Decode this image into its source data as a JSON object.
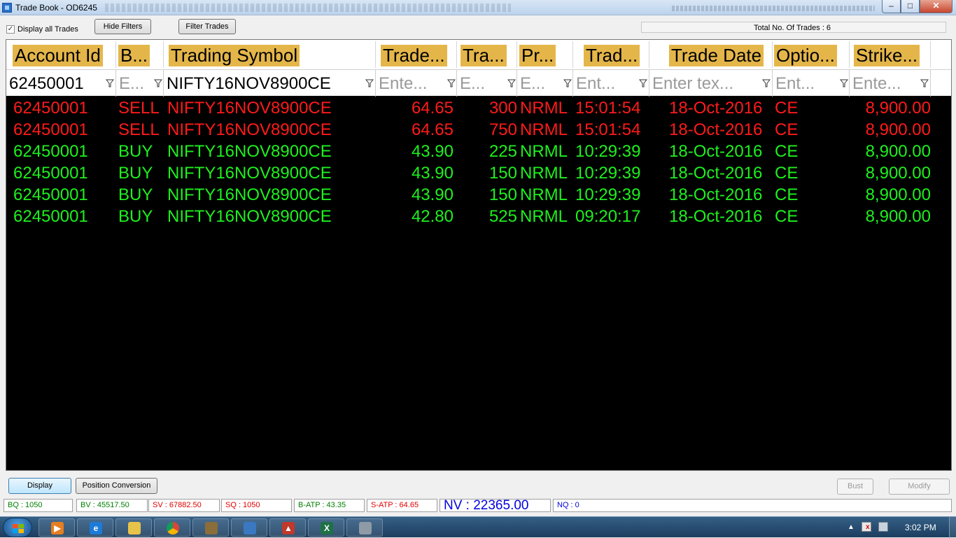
{
  "window": {
    "title": "Trade Book - OD6245"
  },
  "toolbar": {
    "display_all_label": "Display all Trades",
    "display_all_checked": true,
    "hide_filters_label": "Hide Filters",
    "filter_trades_label": "Filter Trades",
    "total_trades_text": "Total No. Of Trades : 6"
  },
  "grid": {
    "headers": [
      "Account Id",
      "B...",
      "Trading Symbol",
      "Trade...",
      "Tra...",
      "Pr...",
      "Trad...",
      "Trade Date",
      "Optio...",
      "Strike..."
    ],
    "filters": [
      {
        "value": "62450001",
        "placeholder": false
      },
      {
        "value": "E...",
        "placeholder": true
      },
      {
        "value": "NIFTY16NOV8900CE",
        "placeholder": false
      },
      {
        "value": "Ente...",
        "placeholder": true
      },
      {
        "value": "E...",
        "placeholder": true
      },
      {
        "value": "E...",
        "placeholder": true
      },
      {
        "value": "Ent...",
        "placeholder": true
      },
      {
        "value": "Enter tex...",
        "placeholder": true
      },
      {
        "value": "Ent...",
        "placeholder": true
      },
      {
        "value": "Ente...",
        "placeholder": true
      }
    ],
    "rows": [
      {
        "side_class": "sell",
        "cells": [
          "62450001",
          "SELL",
          "NIFTY16NOV8900CE",
          "64.65",
          "300",
          "NRML",
          "15:01:54",
          "18-Oct-2016",
          "CE",
          "8,900.00"
        ]
      },
      {
        "side_class": "sell",
        "cells": [
          "62450001",
          "SELL",
          "NIFTY16NOV8900CE",
          "64.65",
          "750",
          "NRML",
          "15:01:54",
          "18-Oct-2016",
          "CE",
          "8,900.00"
        ]
      },
      {
        "side_class": "buy",
        "cells": [
          "62450001",
          "BUY",
          "NIFTY16NOV8900CE",
          "43.90",
          "225",
          "NRML",
          "10:29:39",
          "18-Oct-2016",
          "CE",
          "8,900.00"
        ]
      },
      {
        "side_class": "buy",
        "cells": [
          "62450001",
          "BUY",
          "NIFTY16NOV8900CE",
          "43.90",
          "150",
          "NRML",
          "10:29:39",
          "18-Oct-2016",
          "CE",
          "8,900.00"
        ]
      },
      {
        "side_class": "buy",
        "cells": [
          "62450001",
          "BUY",
          "NIFTY16NOV8900CE",
          "43.90",
          "150",
          "NRML",
          "10:29:39",
          "18-Oct-2016",
          "CE",
          "8,900.00"
        ]
      },
      {
        "side_class": "buy",
        "cells": [
          "62450001",
          "BUY",
          "NIFTY16NOV8900CE",
          "42.80",
          "525",
          "NRML",
          "09:20:17",
          "18-Oct-2016",
          "CE",
          "8,900.00"
        ]
      }
    ]
  },
  "buttons": {
    "display_label": "Display",
    "position_conversion_label": "Position Conversion",
    "bust_label": "Bust",
    "modify_label": "Modify"
  },
  "status": {
    "bq": "BQ : 1050",
    "bv": "BV : 45517.50",
    "sv": "SV : 67882.50",
    "sq": "SQ : 1050",
    "batp": "B-ATP : 43.35",
    "satp": "S-ATP : 64.65",
    "nv": "NV : 22365.00",
    "nq": "NQ : 0"
  },
  "taskbar": {
    "clock": "3:02 PM",
    "apps": [
      "media-player",
      "internet-explorer",
      "file-explorer",
      "chrome",
      "trading-app",
      "app-shortcut",
      "app-triangle",
      "excel",
      "calculator"
    ]
  },
  "colors": {
    "sell": "#ff1a1a",
    "buy": "#1ef01e",
    "header_accent": "#e4b64a",
    "nv": "#0000e0"
  }
}
